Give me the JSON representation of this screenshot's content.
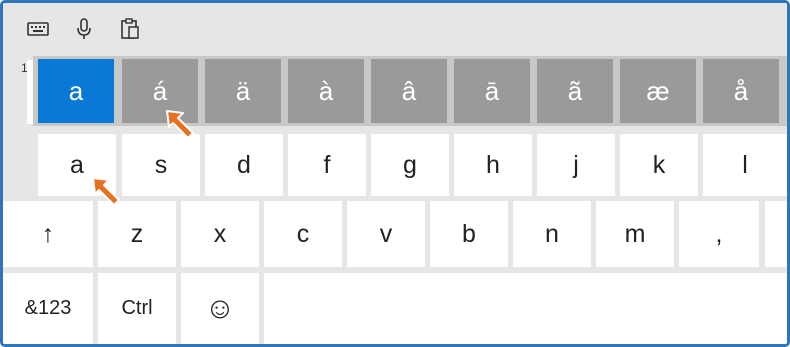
{
  "toolbar": {
    "icons": [
      "keyboard-icon",
      "microphone-icon",
      "clipboard-icon"
    ]
  },
  "candidates": {
    "row_number": "1",
    "keys": [
      "a",
      "á",
      "ä",
      "à",
      "â",
      "ā",
      "ã",
      "æ",
      "å"
    ],
    "selected_index": 0
  },
  "rows": {
    "home": [
      "a",
      "s",
      "d",
      "f",
      "g",
      "h",
      "j",
      "k",
      "l"
    ],
    "bottom": [
      "↑",
      "z",
      "x",
      "c",
      "v",
      "b",
      "n",
      "m",
      ","
    ],
    "space": [
      "&123",
      "Ctrl",
      "☺"
    ]
  },
  "colors": {
    "accent": "#0a78d7",
    "pointer": "#e8711f",
    "frame": "#2f76b9"
  }
}
